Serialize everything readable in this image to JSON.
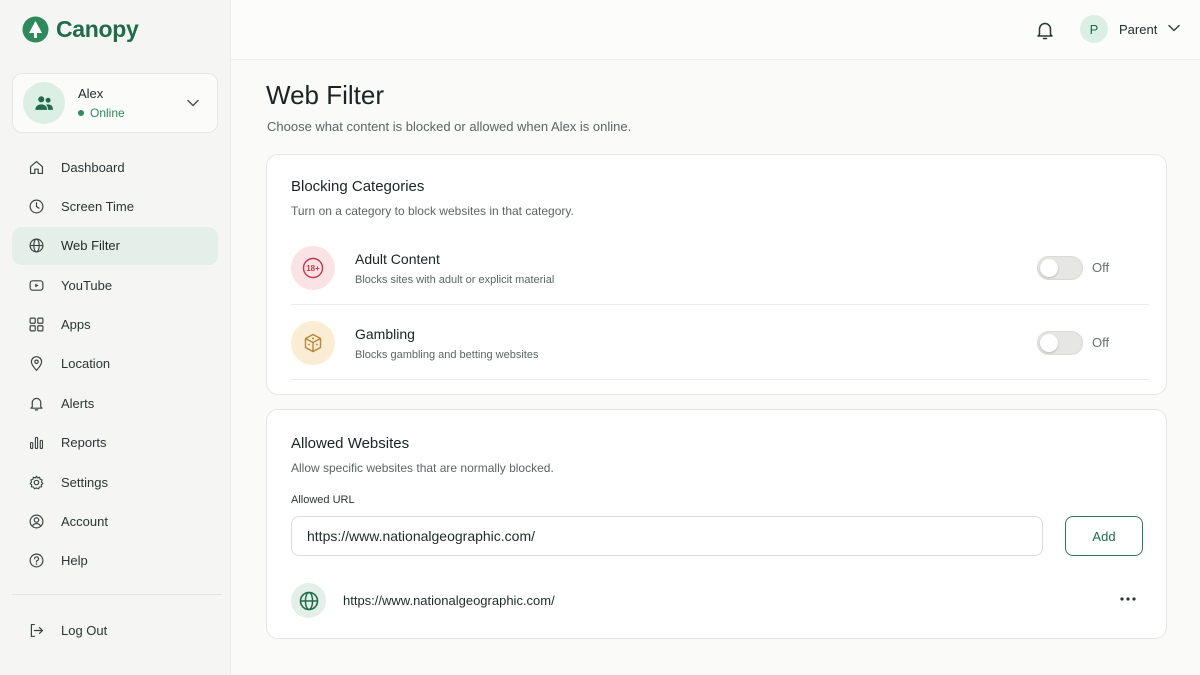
{
  "app": {
    "name": "Canopy",
    "brand_color": "#1f6b4a"
  },
  "profile": {
    "name": "Alex",
    "status": "Online",
    "status_color": "#2e8a5c"
  },
  "sidebar": {
    "items": [
      {
        "label": "Dashboard",
        "icon": "home-icon"
      },
      {
        "label": "Screen Time",
        "icon": "clock-icon"
      },
      {
        "label": "Web Filter",
        "icon": "globe-icon",
        "active": true
      },
      {
        "label": "YouTube",
        "icon": "youtube-icon"
      },
      {
        "label": "Apps",
        "icon": "apps-grid-icon"
      },
      {
        "label": "Location",
        "icon": "location-pin-icon"
      },
      {
        "label": "Alerts",
        "icon": "bell-icon"
      },
      {
        "label": "Reports",
        "icon": "bar-chart-icon"
      },
      {
        "label": "Settings",
        "icon": "gear-icon"
      },
      {
        "label": "Account",
        "icon": "user-circle-icon"
      },
      {
        "label": "Help",
        "icon": "help-circle-icon"
      }
    ],
    "logout_label": "Log Out"
  },
  "topbar": {
    "user_initial": "P",
    "user_label": "Parent"
  },
  "page": {
    "title": "Web Filter",
    "subtitle": "Choose what content is blocked or allowed when Alex is online."
  },
  "blocking": {
    "title": "Blocking Categories",
    "subtitle": "Turn on a category to block websites in that category.",
    "categories": [
      {
        "name": "Adult Content",
        "description": "Blocks sites with adult or explicit material",
        "state": "Off",
        "enabled": false,
        "icon": "adult-18-plus-icon",
        "badge_text": "18+",
        "icon_color": "#c0394b"
      },
      {
        "name": "Gambling",
        "description": "Blocks gambling and betting websites",
        "state": "Off",
        "enabled": false,
        "icon": "dice-icon",
        "icon_color": "#b9853a"
      }
    ]
  },
  "allowed": {
    "title": "Allowed Websites",
    "subtitle": "Allow specific websites that are normally blocked.",
    "field_label": "Allowed URL",
    "input_value": "https://www.nationalgeographic.com/",
    "add_label": "Add",
    "sites": [
      {
        "url": "https://www.nationalgeographic.com/"
      }
    ]
  }
}
